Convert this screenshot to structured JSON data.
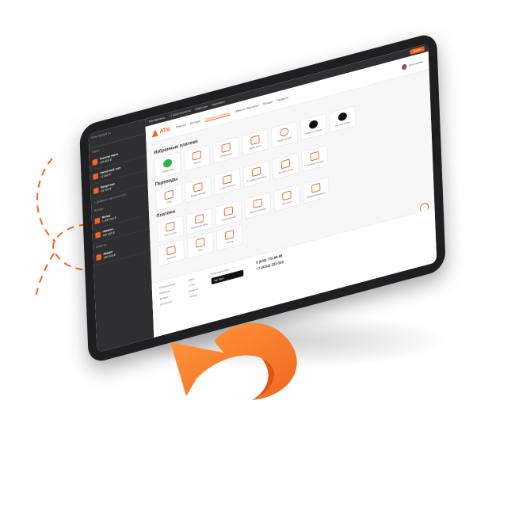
{
  "colors": {
    "accent": "#f26522",
    "dark": "#2f2f31",
    "bezel": "#1f1f22"
  },
  "sidebar": {
    "header": "Мои продукты",
    "section_cards": "Карты",
    "accounts": [
      {
        "title": "Золотая карта",
        "sub": "234 560 ₽"
      },
      {
        "title": "Расчётный счёт",
        "sub": "12 450 ₽"
      },
      {
        "title": "Кредитная",
        "sub": "95 000 ₽"
      }
    ],
    "add_link": "+ Добавить карту или счёт",
    "section_deposits": "Вклады",
    "deposits": [
      {
        "title": "Вклад",
        "sub": "1 000 000 ₽"
      },
      {
        "title": "Накопит.",
        "sub": "450 000 ₽"
      }
    ],
    "section_credits": "Кредиты",
    "credits": [
      {
        "title": "Кредит",
        "sub": "250 000 ₽"
      }
    ]
  },
  "topbar": {
    "items": [
      "Моя финансы",
      "+7 (924) 000-00-00",
      "Отделения",
      "Банкоматы"
    ],
    "cta": "Выйти"
  },
  "header": {
    "logo_text": "АТБ",
    "menu": [
      "Главная",
      "История",
      "Платежи и переводы",
      "Обмен и обменники",
      "Вклады",
      "Продукты"
    ],
    "active_index": 2,
    "user_name": "Константин"
  },
  "favorites": {
    "title": "Избранные платежи",
    "tiles": [
      {
        "label": "Онлайн-банк",
        "icon": "green-circle-icon",
        "kind": "green"
      },
      {
        "label": "Оплата",
        "icon": "card-icon",
        "kind": ""
      },
      {
        "label": "Коммуналка",
        "icon": "house-icon",
        "kind": ""
      },
      {
        "label": "Новая карта",
        "icon": "card-icon",
        "kind": ""
      },
      {
        "label": "Кредит онлайн",
        "icon": "coin-icon",
        "kind": "circ"
      },
      {
        "label": "Изменить платеж",
        "icon": "steam-icon",
        "kind": "dark"
      },
      {
        "label": "На пополнение",
        "icon": "steam-icon",
        "kind": "dark"
      }
    ]
  },
  "transfers": {
    "title": "Переводы",
    "tiles": [
      {
        "label": "Себе",
        "icon": "person-icon"
      },
      {
        "label": "Между счетами",
        "icon": "exchange-icon"
      },
      {
        "label": "С карты на карту",
        "icon": "cards-icon"
      },
      {
        "label": "По номеру телефона",
        "icon": "phone-icon"
      },
      {
        "label": "Частным лицам",
        "icon": "wallet-icon"
      },
      {
        "label": "Перевод в валюте",
        "icon": "currency-icon"
      }
    ]
  },
  "payments": {
    "title": "Платежи",
    "tiles": [
      {
        "label": "Оплата услуг",
        "icon": "coin-icon"
      },
      {
        "label": "Мобильная связь",
        "icon": "mobile-icon"
      },
      {
        "label": "Коммунальные",
        "icon": "house-icon"
      },
      {
        "label": "Налоги и штрафы",
        "icon": "doc-icon"
      },
      {
        "label": "Транспорт",
        "icon": "plane-icon"
      },
      {
        "label": "Погашение кредита",
        "icon": "bag-icon"
      },
      {
        "label": "Интернет",
        "icon": "globe-icon"
      },
      {
        "label": "Игры",
        "icon": "gamepad-icon"
      },
      {
        "label": "Прочее",
        "icon": "dots-icon"
      }
    ]
  },
  "footer": {
    "col1": [
      "Обслуживание",
      "Контакты",
      "Вклады",
      "Документы"
    ],
    "col2": [
      "Карты",
      "Счета",
      "Кредиты",
      "Вклады"
    ],
    "app_title": "Мобильный банк",
    "app_store": "App Store",
    "phone1": "8 (800) 775-88-88",
    "phone2": "+7 (4162) 222-333"
  }
}
